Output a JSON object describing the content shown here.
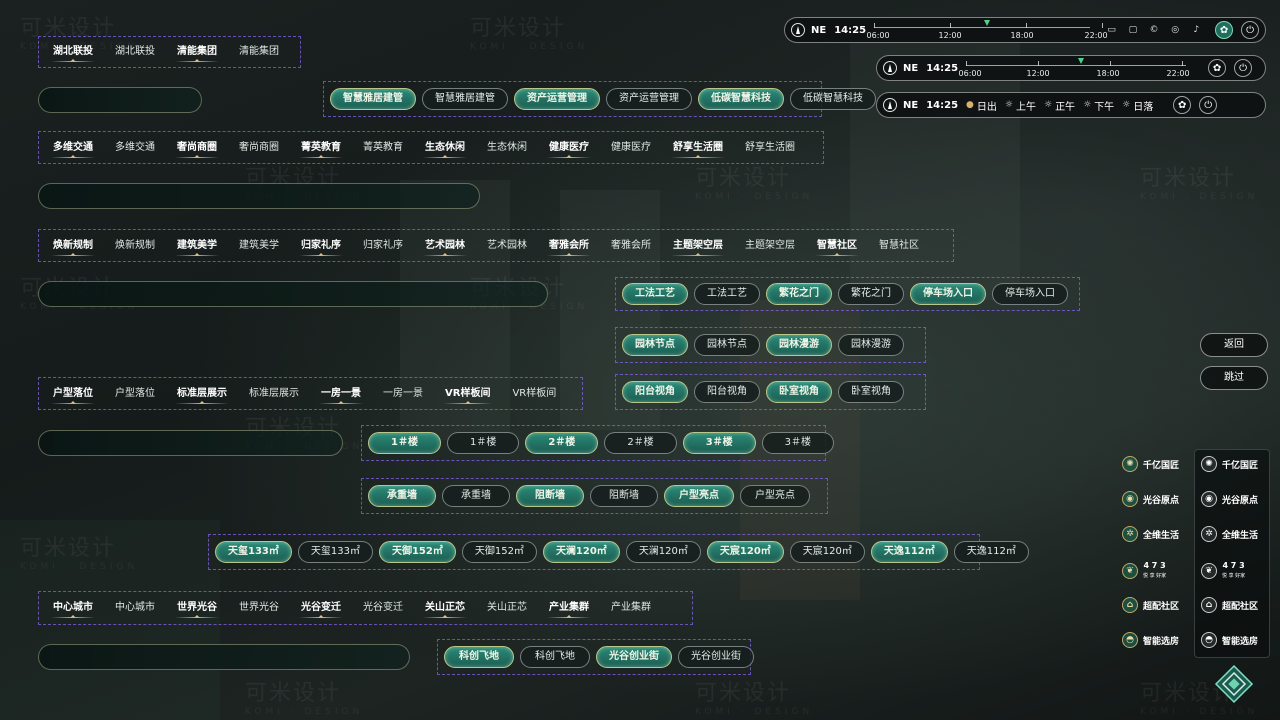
{
  "watermark": {
    "text": "可米设计",
    "sub": "KOMI · DESIGN"
  },
  "rows": {
    "r1": [
      "湖北联投",
      "湖北联投",
      "清能集团",
      "清能集团"
    ],
    "r2": [
      "智慧雅居建管",
      "智慧雅居建管",
      "资产运营管理",
      "资产运营管理",
      "低碳智慧科技",
      "低碳智慧科技"
    ],
    "r3": [
      "多维交通",
      "多维交通",
      "奢尚商圈",
      "奢尚商圈",
      "菁英教育",
      "菁英教育",
      "生态休闲",
      "生态休闲",
      "健康医疗",
      "健康医疗",
      "舒享生活圈",
      "舒享生活圈"
    ],
    "r4": [
      "焕新规制",
      "焕新规制",
      "建筑美学",
      "建筑美学",
      "归家礼序",
      "归家礼序",
      "艺术园林",
      "艺术园林",
      "奢雅会所",
      "奢雅会所",
      "主题架空层",
      "主题架空层",
      "智慧社区",
      "智慧社区"
    ],
    "r5": [
      "工法工艺",
      "工法工艺",
      "繁花之门",
      "繁花之门",
      "停车场入口",
      "停车场入口"
    ],
    "r6": [
      "园林节点",
      "园林节点",
      "园林漫游",
      "园林漫游"
    ],
    "r7": [
      "户型落位",
      "户型落位",
      "标准层展示",
      "标准层展示",
      "一房一景",
      "一房一景",
      "VR样板间",
      "VR样板间"
    ],
    "r8": [
      "阳台视角",
      "阳台视角",
      "卧室视角",
      "卧室视角"
    ],
    "r9": [
      "1＃楼",
      "1＃楼",
      "2＃楼",
      "2＃楼",
      "3＃楼",
      "3＃楼"
    ],
    "r10": [
      "承重墙",
      "承重墙",
      "阻断墙",
      "阻断墙",
      "户型亮点",
      "户型亮点"
    ],
    "r11": [
      "天玺133㎡",
      "天玺133㎡",
      "天御152㎡",
      "天御152㎡",
      "天澜120㎡",
      "天澜120㎡",
      "天宸120㎡",
      "天宸120㎡",
      "天逸112㎡",
      "天逸112㎡"
    ],
    "r12": [
      "中心城市",
      "中心城市",
      "世界光谷",
      "世界光谷",
      "光谷变迁",
      "光谷变迁",
      "关山正芯",
      "关山正芯",
      "产业集群",
      "产业集群"
    ],
    "r13": [
      "科创飞地",
      "科创飞地",
      "光谷创业街",
      "光谷创业街"
    ]
  },
  "status": {
    "dir": "NE",
    "time": "14:25",
    "ticks": [
      "06:00",
      "12:00",
      "18:00",
      "22:00"
    ],
    "sun_progress": 0.52,
    "periods": [
      "日出",
      "上午",
      "正午",
      "下午",
      "日落"
    ]
  },
  "side": {
    "back": "返回",
    "skip": "跳过"
  },
  "menu": [
    "千亿国匠",
    "光谷原点",
    "全维生活",
    "4 7 3",
    "超配社区",
    "智能选房"
  ],
  "menu_sub": "悦 享 好家",
  "colors": {
    "accent": "#1f7a68",
    "gold": "#d9b06a",
    "group_border": "#8264e6"
  }
}
